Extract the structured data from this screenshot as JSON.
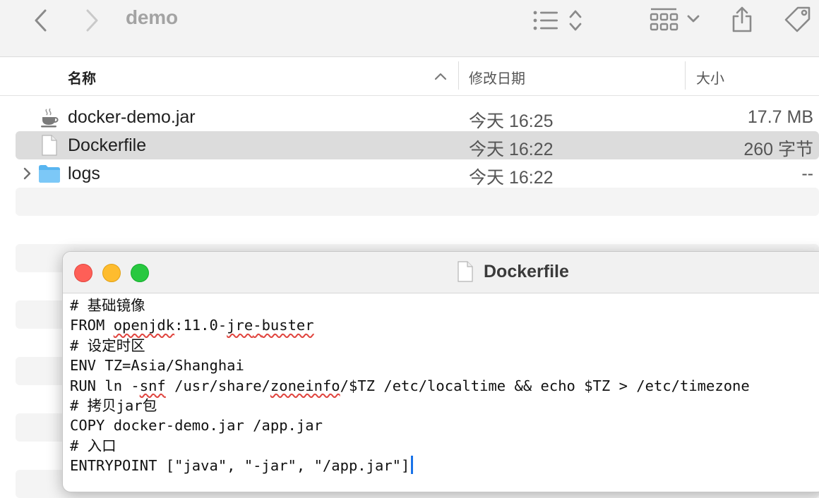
{
  "finder": {
    "title": "demo",
    "columns": {
      "name": "名称",
      "date": "修改日期",
      "size": "大小"
    },
    "files": [
      {
        "name": "docker-demo.jar",
        "date": "今天 16:25",
        "size": "17.7 MB",
        "icon": "java-jar-icon",
        "selected": false
      },
      {
        "name": "Dockerfile",
        "date": "今天 16:22",
        "size": "260 字节",
        "icon": "document-icon",
        "selected": true
      },
      {
        "name": "logs",
        "date": "今天 16:22",
        "size": "--",
        "icon": "folder-icon",
        "selected": false
      }
    ]
  },
  "editor": {
    "title": "Dockerfile",
    "lines": [
      "# 基础镜像",
      "FROM openjdk:11.0-jre-buster",
      "# 设定时区",
      "ENV TZ=Asia/Shanghai",
      "RUN ln -snf /usr/share/zoneinfo/$TZ /etc/localtime && echo $TZ > /etc/timezone",
      "# 拷贝jar包",
      "COPY docker-demo.jar /app.jar",
      "# 入口",
      "ENTRYPOINT [\"java\", \"-jar\", \"/app.jar\"]"
    ],
    "line2_parts": [
      "FROM ",
      "openjdk",
      ":11.0-",
      "jre",
      "-",
      "buster"
    ],
    "line5_parts": [
      "RUN ln -",
      "snf",
      " /usr/share/",
      "zoneinfo",
      "/$TZ /etc/localtime && echo $TZ > /etc/timezone"
    ]
  }
}
